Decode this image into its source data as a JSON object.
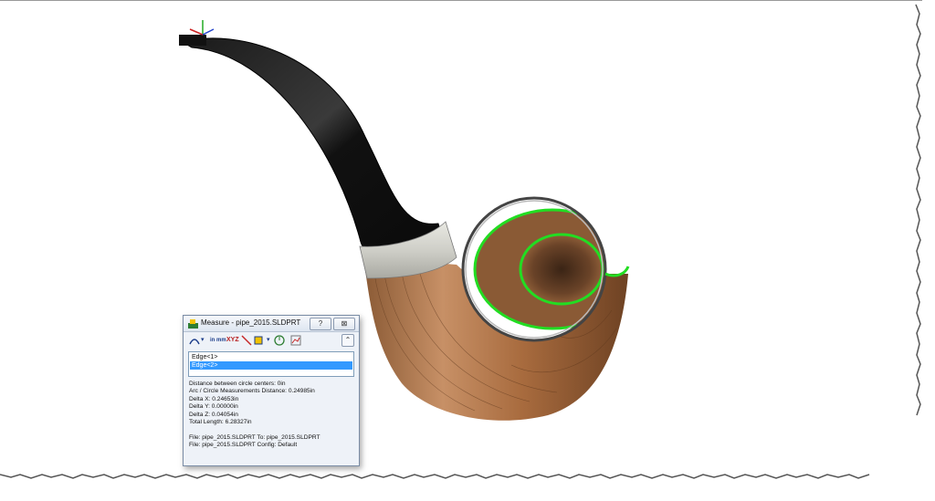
{
  "dialog": {
    "title": "Measure - pipe_2015.SLDPRT",
    "help_label": "?",
    "close_label": "⊠",
    "collapse_label": "⌃",
    "toolbar": {
      "units_label": "in mm",
      "xyz_label": "XYZ"
    },
    "selections": [
      {
        "label": "Edge<1>",
        "selected": false
      },
      {
        "label": "Edge<2>",
        "selected": true
      }
    ],
    "results": [
      "Distance between circle centers:  0in",
      "Arc / Circle Measurements Distance: 0.24985in",
      "Delta X: 0.24653in",
      "Delta Y: 0.00000in",
      "Delta Z: 0.04054in",
      "Total Length: 6.28327in"
    ],
    "file_lines": [
      "File: pipe_2015.SLDPRT To: pipe_2015.SLDPRT",
      "File: pipe_2015.SLDPRT Config: Default"
    ]
  },
  "viewport": {
    "triad_labels": [
      "X",
      "Y",
      "Z"
    ],
    "highlight_color": "#22dd22",
    "model_name": "pipe"
  }
}
